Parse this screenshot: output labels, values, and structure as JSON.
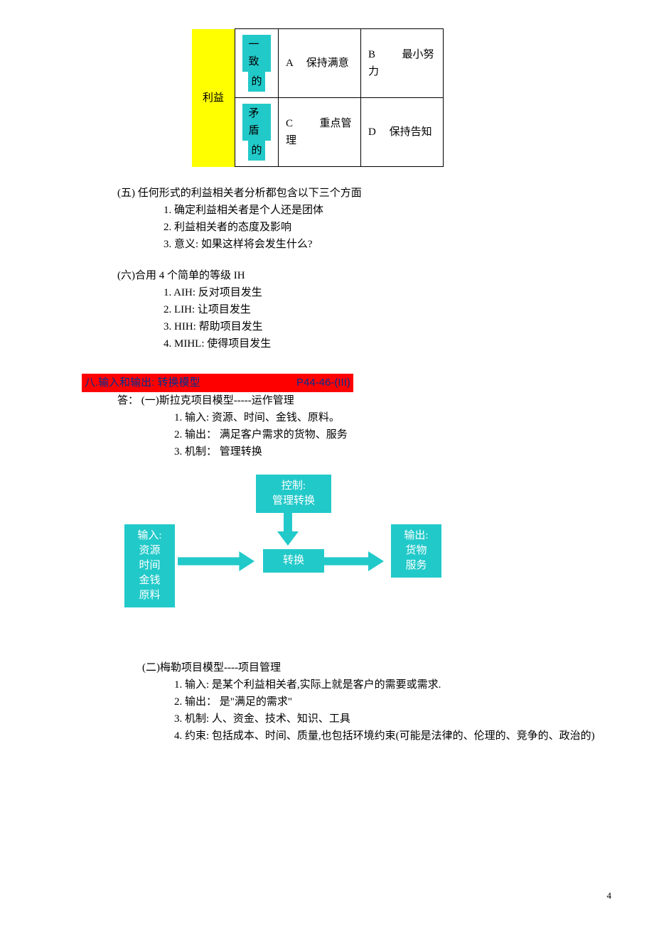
{
  "matrix": {
    "leftHeader": "利益",
    "row1_sub": "一 致的",
    "row1_cellA": "A      　保持满意",
    "row1_cellB": "B   　　 最小努力",
    "row2_sub": "矛 盾的",
    "row2_cellC": "C   　　 重点管理",
    "row2_cellD": "D      　保持告知"
  },
  "section5": {
    "title": "(五) 任何形式的利益相关者分析都包含以下三个方面",
    "items": [
      "1. 确定利益相关者是个人还是团体",
      "2. 利益相关者的态度及影响",
      "3. 意义: 如果这样将会发生什么?"
    ]
  },
  "section6": {
    "title": "(六)合用 4 个简单的等级 IH",
    "items": [
      "1. AIH: 反对项目发生",
      "2. LIH: 让项目发生",
      "3. HIH: 帮助项目发生",
      "4. MIHL: 使得项目发生"
    ]
  },
  "redHeader": {
    "left": "八.输入和输出: 转换模型",
    "right": "P44-46-(III)"
  },
  "model1": {
    "title": "答： (一)斯拉克项目模型-----运作管理",
    "items": [
      "1. 输入: 资源、时间、金钱、原料。",
      "2. 输出：  满足客户需求的货物、服务",
      "3. 机制：  管理转换"
    ]
  },
  "diagram": {
    "input": "输入:\n资源\n时间\n金钱\n原料",
    "control": "控制:\n管理转换",
    "transform": "转换",
    "output": "输出:\n货物\n服务"
  },
  "model2": {
    "title": "(二)梅勒项目模型----项目管理",
    "items": [
      "1. 输入: 是某个利益相关者,实际上就是客户的需要或需求.",
      "2. 输出：  是\"满足的需求\"",
      "3. 机制: 人、资金、技术、知识、工具",
      "4. 约束: 包括成本、时间、质量,也包括环境约束(可能是法律的、伦理的、竞争的、政治的)"
    ]
  },
  "pageNum": "4"
}
